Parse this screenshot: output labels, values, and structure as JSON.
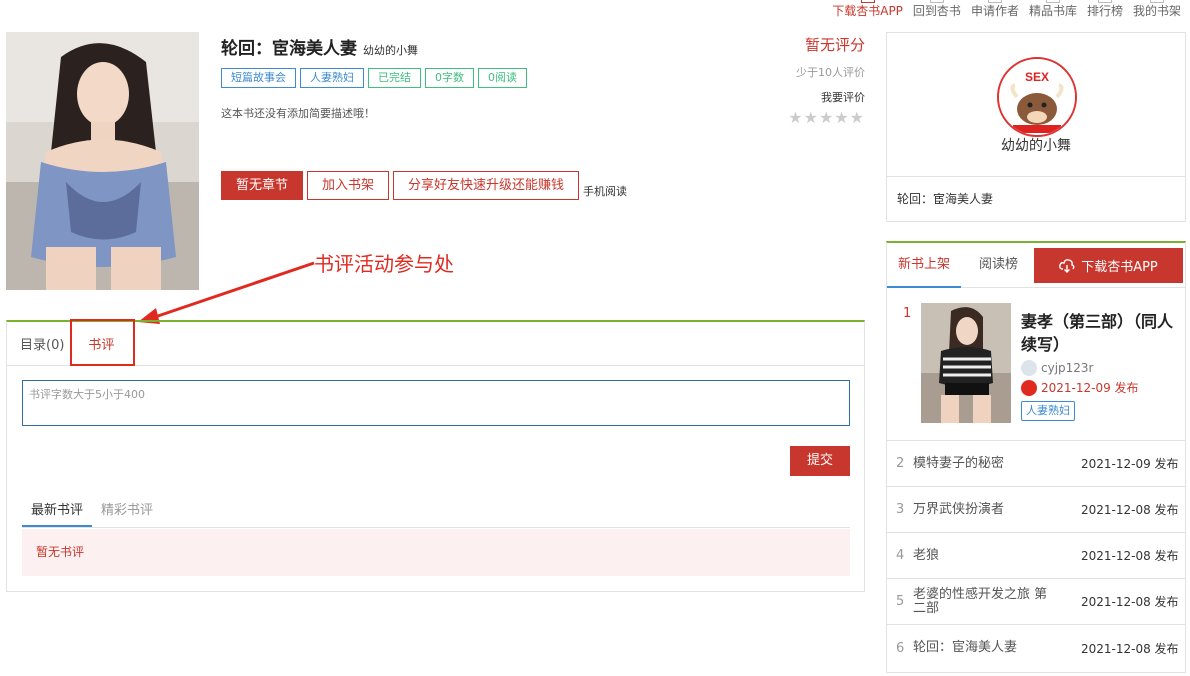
{
  "topnav": [
    {
      "label": "下载杏书APP",
      "active": true
    },
    {
      "label": "回到杏书",
      "active": false
    },
    {
      "label": "申请作者",
      "active": false
    },
    {
      "label": "精品书库",
      "active": false
    },
    {
      "label": "排行榜",
      "active": false
    },
    {
      "label": "我的书架",
      "active": false
    }
  ],
  "book": {
    "title": "轮回：宦海美人妻",
    "author": "幼幼的小舞",
    "tags": [
      "短篇故事会",
      "人妻熟妇",
      "已完结",
      "0字数",
      "0阅读"
    ],
    "description": "这本书还没有添加简要描述哦！",
    "buttons": {
      "read": "暂无章节",
      "shelf": "加入书架",
      "share": "分享好友快速升级还能赚钱",
      "mobile": "手机阅读"
    }
  },
  "rating": {
    "score_text": "暂无评分",
    "count_text": "少于10人评价",
    "rate_label": "我要评价",
    "stars": "★★★★★"
  },
  "annotation": {
    "text": "书评活动参与处"
  },
  "panel": {
    "tabs": [
      "目录(0)",
      "书评"
    ],
    "placeholder": "书评字数大于5小于400",
    "submit": "提交",
    "sub_tabs": [
      "最新书评",
      "精彩书评"
    ],
    "empty": "暂无书评"
  },
  "author_card": {
    "name": "幼幼的小舞",
    "book": "轮回：宦海美人妻",
    "logo_text": "SEX"
  },
  "list_card": {
    "tabs": [
      "新书上架",
      "阅读榜"
    ],
    "download": "下载杏书APP",
    "top": {
      "rank": "1",
      "title": "妻孝（第三部）（同人续写）",
      "author": "cyjp123r",
      "date": "2021-12-09 发布",
      "tag": "人妻熟妇"
    },
    "rows": [
      {
        "rank": "2",
        "title": "模特妻子的秘密",
        "date": "2021-12-09 发布"
      },
      {
        "rank": "3",
        "title": "万界武侠扮演者",
        "date": "2021-12-08 发布"
      },
      {
        "rank": "4",
        "title": "老狼",
        "date": "2021-12-08 发布"
      },
      {
        "rank": "5",
        "title": "老婆的性感开发之旅 第二部",
        "date": "2021-12-08 发布"
      },
      {
        "rank": "6",
        "title": "轮回：宦海美人妻",
        "date": "2021-12-08 发布"
      }
    ]
  }
}
